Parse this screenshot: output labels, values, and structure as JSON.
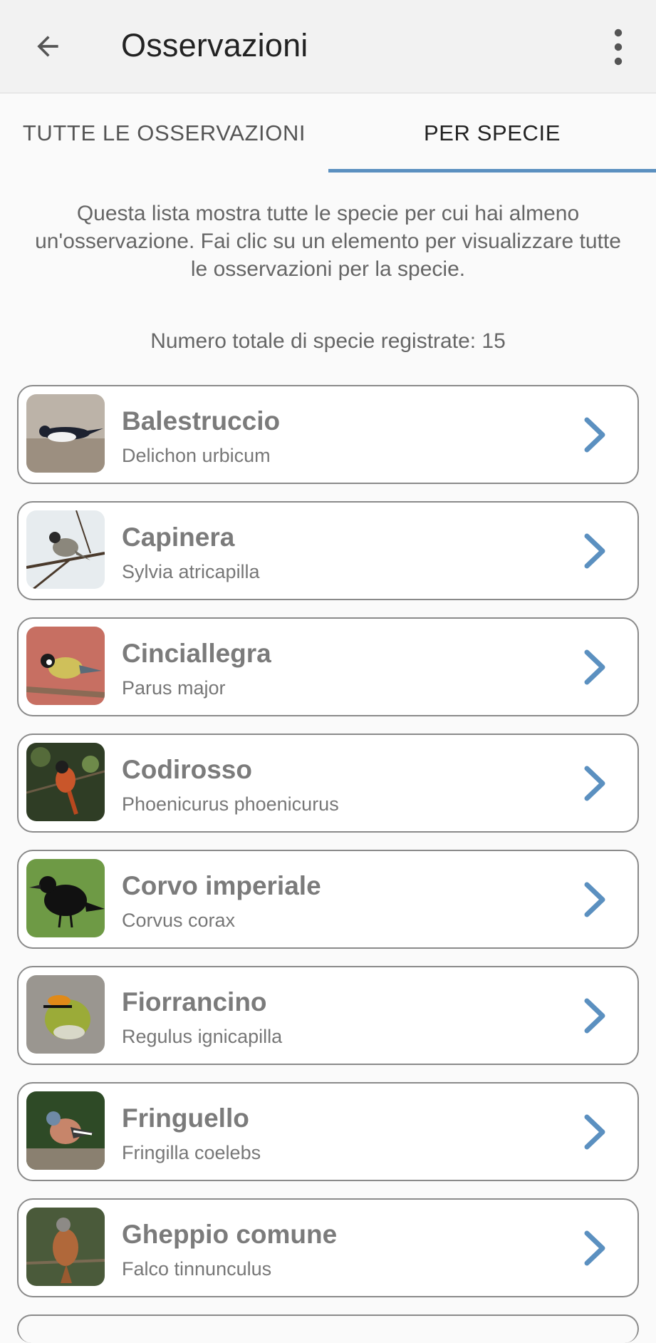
{
  "app_bar": {
    "title": "Osservazioni",
    "back_icon": "arrow-left-icon",
    "menu_icon": "more-vert-icon"
  },
  "tabs": [
    {
      "label": "TUTTE LE OSSERVAZIONI",
      "selected": false
    },
    {
      "label": "PER SPECIE",
      "selected": true
    }
  ],
  "intro_text": "Questa lista mostra tutte le specie per cui hai almeno un'osservazione. Fai clic su un elemento per visualizzare tutte le osservazioni per la specie.",
  "total_count_text": "Numero totale di specie registrate: 15",
  "species": [
    {
      "common": "Balestruccio",
      "scientific": "Delichon urbicum"
    },
    {
      "common": "Capinera",
      "scientific": "Sylvia atricapilla"
    },
    {
      "common": "Cinciallegra",
      "scientific": "Parus major"
    },
    {
      "common": "Codirosso",
      "scientific": "Phoenicurus phoenicurus"
    },
    {
      "common": "Corvo imperiale",
      "scientific": "Corvus corax"
    },
    {
      "common": "Fiorrancino",
      "scientific": "Regulus ignicapilla"
    },
    {
      "common": "Fringuello",
      "scientific": "Fringilla coelebs"
    },
    {
      "common": "Gheppio comune",
      "scientific": "Falco tinnunculus"
    }
  ],
  "colors": {
    "accent": "#5b90c0",
    "chevron": "#5b90c0",
    "card_border": "#8a8a8a",
    "appbar_bg": "#f2f2f2"
  }
}
